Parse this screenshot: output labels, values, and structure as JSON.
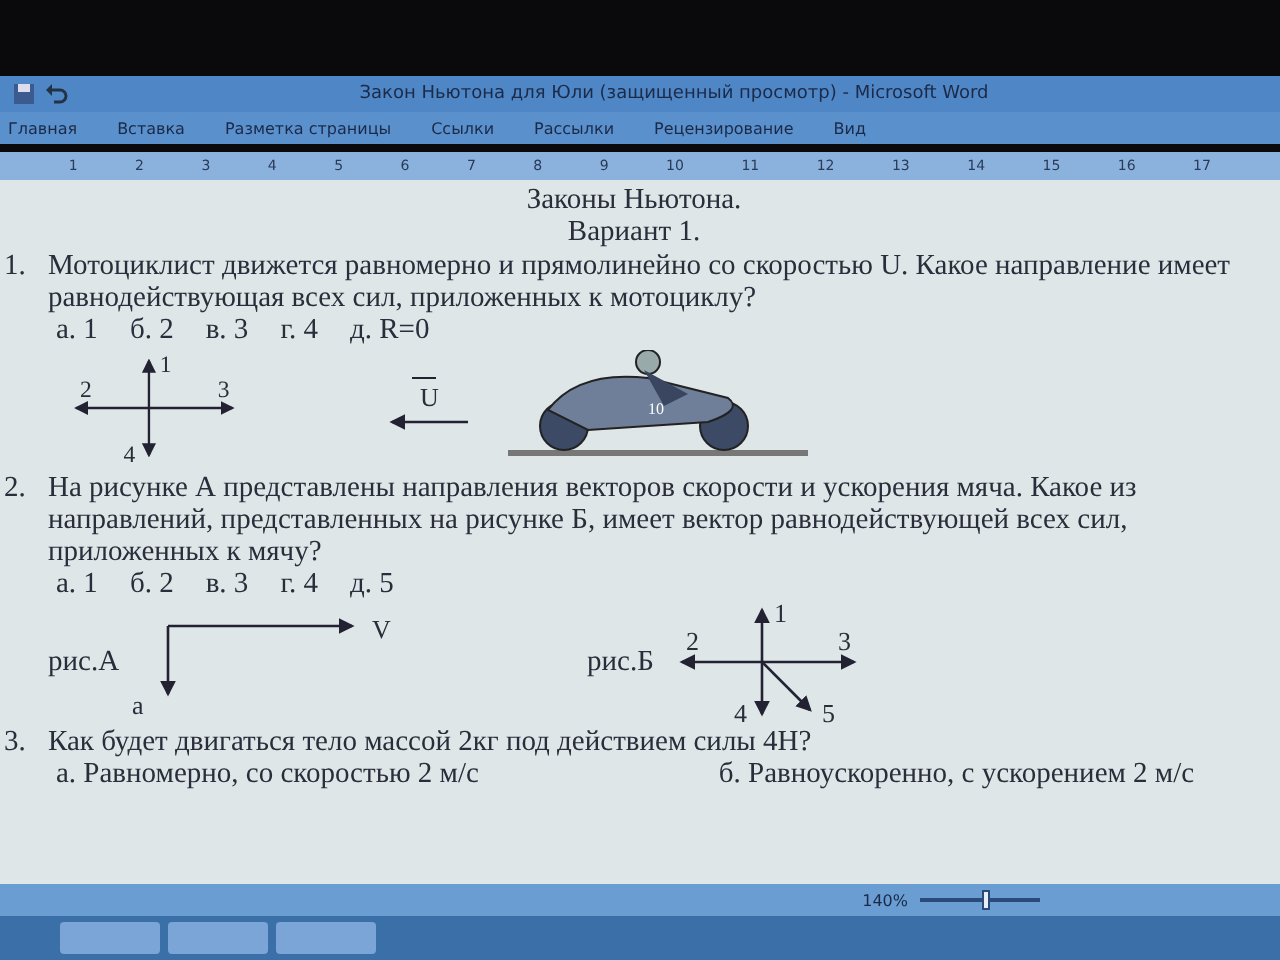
{
  "window": {
    "title": "Закон Ньютона для Юли (защищенный просмотр) - Microsoft Word"
  },
  "ribbon": {
    "tabs": [
      "Главная",
      "Вставка",
      "Разметка страницы",
      "Ссылки",
      "Рассылки",
      "Рецензирование",
      "Вид"
    ]
  },
  "ruler": {
    "marks": [
      "1",
      "2",
      "3",
      "4",
      "5",
      "6",
      "7",
      "8",
      "9",
      "10",
      "11",
      "12",
      "13",
      "14",
      "15",
      "16",
      "17"
    ]
  },
  "document": {
    "title": "Законы Ньютона.",
    "subtitle": "Вариант 1.",
    "questions": [
      {
        "number": "1.",
        "text": "Мотоциклист движется равномерно и прямолинейно со скоростью U. Какое направление имеет равнодействующая всех сил, приложенных к мотоциклу?",
        "options": [
          "а. 1",
          "б. 2",
          "в. 3",
          "г. 4",
          "д. R=0"
        ],
        "figures": [
          {
            "kind": "cross",
            "labels": [
              "1",
              "2",
              "3",
              "4"
            ]
          },
          {
            "kind": "motorcycle",
            "labels": [
              "U",
              "10"
            ]
          }
        ]
      },
      {
        "number": "2.",
        "text": "На рисунке А представлены направления векторов скорости и ускорения мяча. Какое из направлений, представленных на рисунке Б, имеет вектор равнодействующей всех сил, приложенных к мячу?",
        "options": [
          "а. 1",
          "б. 2",
          "в. 3",
          "г. 4",
          "д. 5"
        ],
        "figures": [
          {
            "kind": "velocity",
            "caption": "рис.А",
            "labels": [
              "V",
              "a"
            ]
          },
          {
            "kind": "cross",
            "caption": "рис.Б",
            "labels": [
              "1",
              "2",
              "3",
              "4",
              "5"
            ]
          }
        ]
      },
      {
        "number": "3.",
        "text": "Как будет двигаться тело массой 2кг под действием силы 4Н?",
        "options": [
          "а. Равномерно, со скоростью 2 м/с",
          "б. Равноускоренно, с ускорением 2 м/с"
        ]
      }
    ]
  },
  "status_bar": {
    "zoom": "140%",
    "zoom_slider": {
      "level": 0.55
    }
  }
}
